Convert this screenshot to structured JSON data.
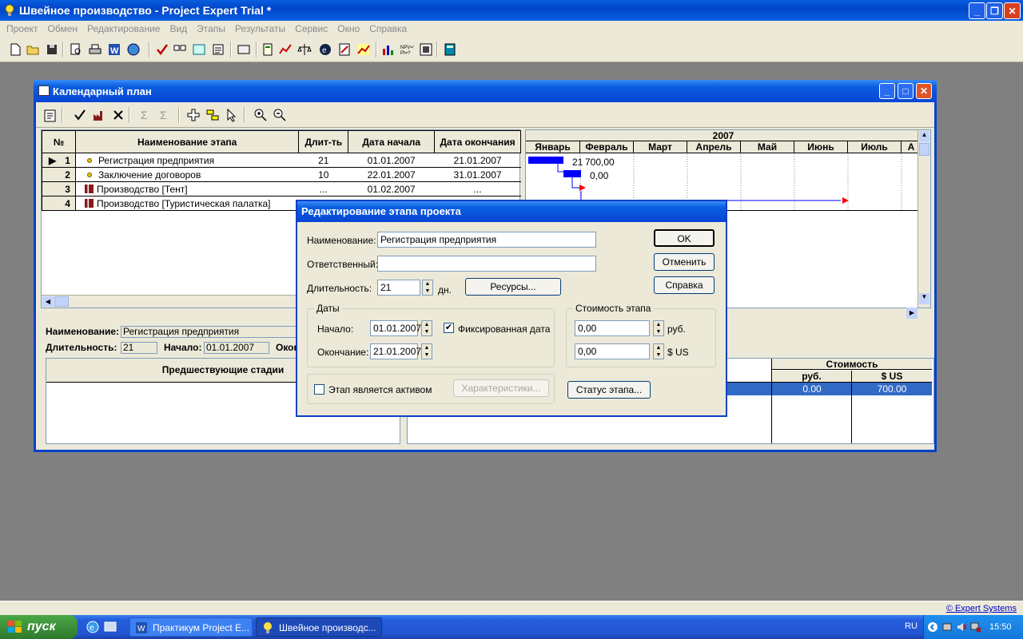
{
  "app": {
    "title": "Швейное производство - Project Expert Trial *"
  },
  "menu": [
    "Проект",
    "Обмен",
    "Редактирование",
    "Вид",
    "Этапы",
    "Результаты",
    "Сервис",
    "Окно",
    "Справка"
  ],
  "child": {
    "title": "Календарный план"
  },
  "grid": {
    "headers": {
      "num": "№",
      "name": "Наименование этапа",
      "dur": "Длит-ть",
      "start": "Дата начала",
      "end": "Дата окончания"
    },
    "rows": [
      {
        "num": "1",
        "name": "Регистрация предприятия",
        "dur": "21",
        "start": "01.01.2007",
        "end": "21.01.2007",
        "kind": "stage"
      },
      {
        "num": "2",
        "name": "Заключение договоров",
        "dur": "10",
        "start": "22.01.2007",
        "end": "31.01.2007",
        "kind": "stage"
      },
      {
        "num": "3",
        "name": "Производство [Тент]",
        "dur": "...",
        "start": "01.02.2007",
        "end": "...",
        "kind": "production"
      },
      {
        "num": "4",
        "name": "Производство [Туристическая палатка]",
        "dur": "",
        "start": "",
        "end": "",
        "kind": "production"
      }
    ]
  },
  "gantt": {
    "year": "2007",
    "months": [
      "Январь",
      "Февраль",
      "Март",
      "Апрель",
      "Май",
      "Июнь",
      "Июль",
      "А"
    ],
    "bar_labels": {
      "row1_dur": "21",
      "row1_cost": "700,00",
      "row2_cost": "0,00"
    }
  },
  "bottom": {
    "name_label": "Наименование:",
    "name_value": "Регистрация предприятия",
    "dur_label": "Длительность:",
    "dur_value": "21",
    "start_label": "Начало:",
    "start_value": "01.01.2007",
    "end_label": "Оконч",
    "pred_header": "Предшествующие стадии",
    "cost_header": "Стоимость",
    "rub_header": "руб.",
    "usd_header": "$ US",
    "rub_value": "0.00",
    "usd_value": "700.00"
  },
  "dialog": {
    "title": "Редактирование этапа проекта",
    "name_label": "Наименование:",
    "name_value": "Регистрация предприятия",
    "resp_label": "Ответственный:",
    "resp_value": "",
    "dur_label": "Длительность:",
    "dur_value": "21",
    "dur_unit": "дн.",
    "resources_btn": "Ресурсы...",
    "ok_btn": "OK",
    "cancel_btn": "Отменить",
    "help_btn": "Справка",
    "dates_group": "Даты",
    "start_label": "Начало:",
    "start_value": "01.01.2007",
    "fixed_date_label": "Фиксированная дата",
    "fixed_date_checked": true,
    "end_label": "Окончание:",
    "end_value": "21.01.2007",
    "cost_group": "Стоимость этапа",
    "cost_rub": "0,00",
    "cost_rub_unit": "руб.",
    "cost_usd": "0,00",
    "cost_usd_unit": "$ US",
    "asset_label": "Этап является активом",
    "asset_checked": false,
    "characteristics_btn": "Характеристики...",
    "status_btn": "Статус этапа..."
  },
  "statusbar": {
    "copyright": "© Expert Systems"
  },
  "taskbar": {
    "start": "пуск",
    "tasks": [
      "Практикум Project E...",
      "Швейное производс..."
    ],
    "lang": "RU",
    "time": "15:50"
  },
  "colors": {
    "title_blue": "#0a5ee0",
    "gantt_bar": "#0000ff",
    "milestone_red": "#ff0000",
    "selection": "#316ac5"
  }
}
